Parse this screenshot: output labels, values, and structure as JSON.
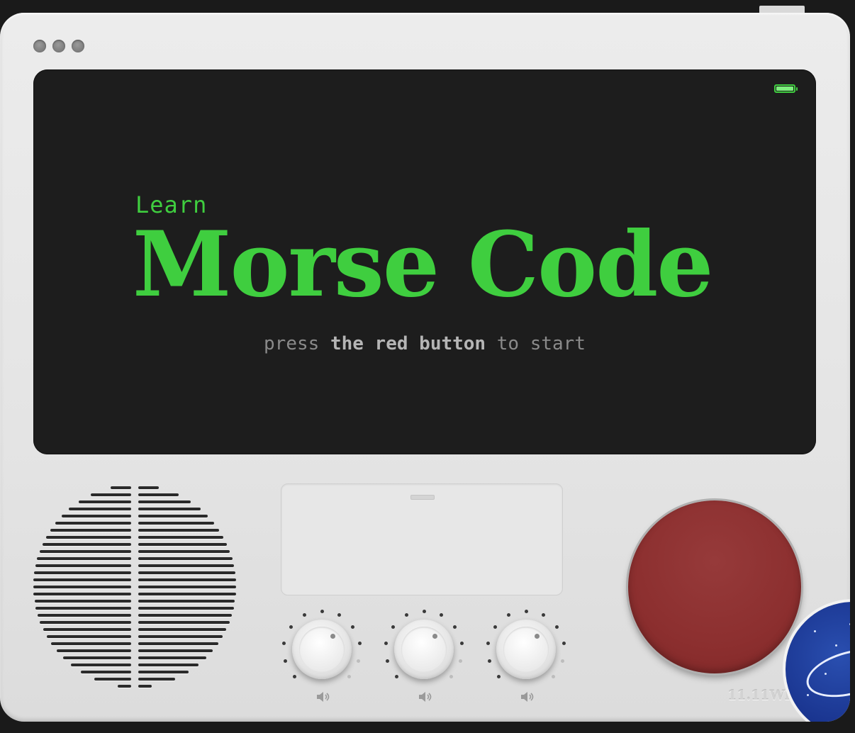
{
  "window": {
    "controls": [
      "close",
      "minimize",
      "maximize"
    ]
  },
  "screen": {
    "battery_icon": "battery-full-icon",
    "battery_level": 1.0,
    "kicker": "Learn",
    "title": "Morse Code",
    "instruction": {
      "part1": "press ",
      "emphasis": "the red button",
      "part2": " to start"
    }
  },
  "controls": {
    "knobs": [
      {
        "id": "knob-1",
        "icon": "volume-icon"
      },
      {
        "id": "knob-2",
        "icon": "volume-icon"
      },
      {
        "id": "knob-3",
        "icon": "volume-icon"
      }
    ],
    "red_button_icon": "red-key-button"
  },
  "device": {
    "capacity_label": "11.11Wh"
  },
  "colors": {
    "screen_text": "#3fce3f",
    "screen_bg": "#1d1d1d",
    "red_button": "#8c2f2f",
    "body": "#e6e6e6"
  }
}
